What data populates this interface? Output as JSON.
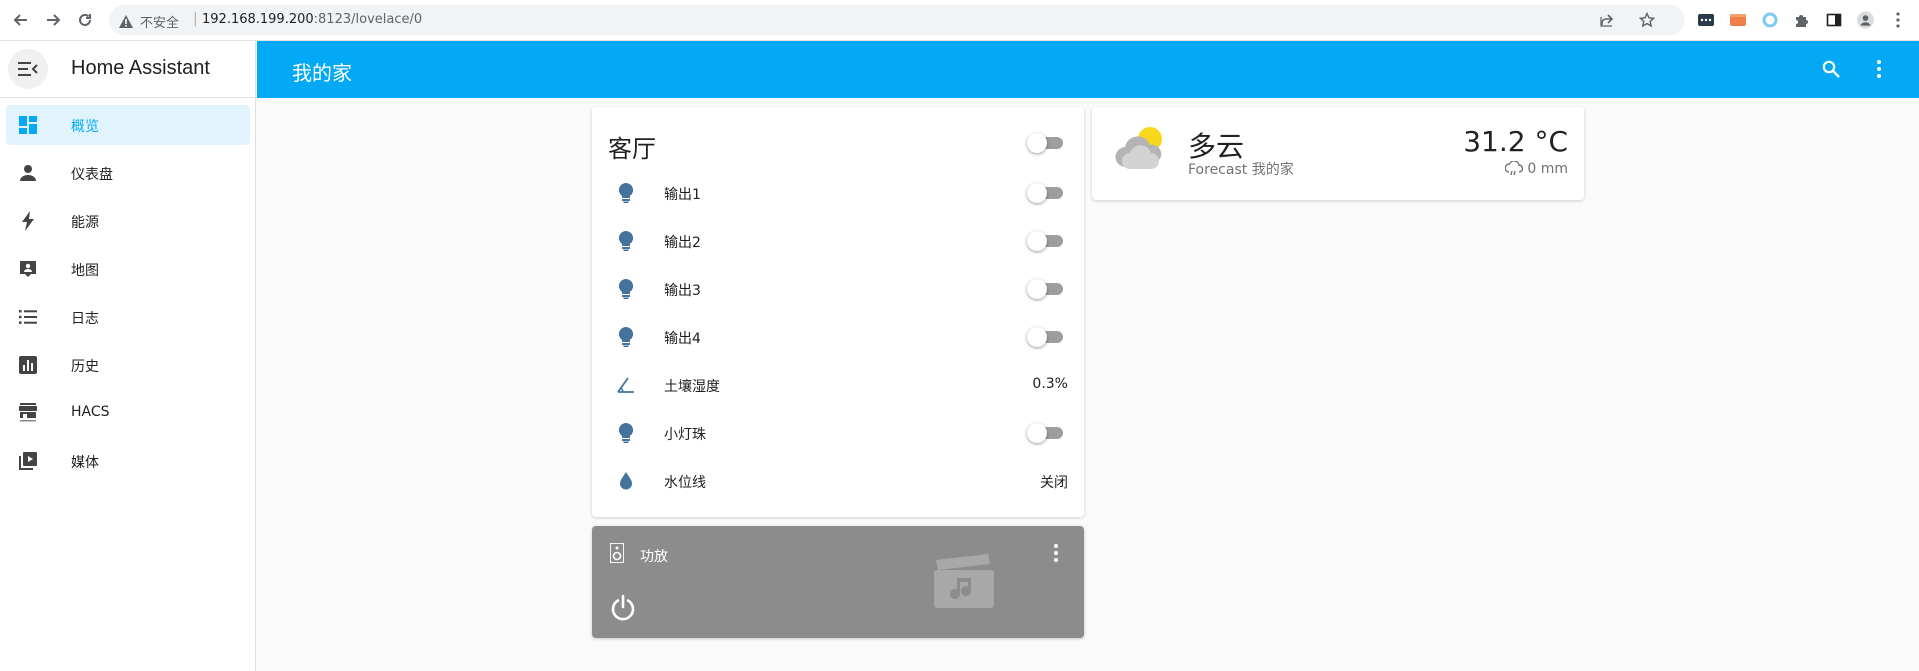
{
  "browser": {
    "insecure_label": "不安全",
    "url_host": "192.168.199.200",
    "url_path": ":8123/lovelace/0"
  },
  "sidebar": {
    "title": "Home Assistant",
    "items": [
      {
        "label": "概览",
        "icon": "dashboard-icon",
        "active": true
      },
      {
        "label": "仪表盘",
        "icon": "person-icon"
      },
      {
        "label": "能源",
        "icon": "lightning-bolt-icon"
      },
      {
        "label": "地图",
        "icon": "map-icon"
      },
      {
        "label": "日志",
        "icon": "list-icon"
      },
      {
        "label": "历史",
        "icon": "chart-box-icon"
      },
      {
        "label": "HACS",
        "icon": "hacs-icon"
      },
      {
        "label": "媒体",
        "icon": "play-box-multiple-icon"
      }
    ]
  },
  "header": {
    "title": "我的家"
  },
  "entities_card": {
    "title": "客厅",
    "header_toggle": false,
    "rows": [
      {
        "label": "输出1",
        "icon": "lightbulb-icon",
        "type": "toggle",
        "state": false
      },
      {
        "label": "输出2",
        "icon": "lightbulb-icon",
        "type": "toggle",
        "state": false
      },
      {
        "label": "输出3",
        "icon": "lightbulb-icon",
        "type": "toggle",
        "state": false
      },
      {
        "label": "输出4",
        "icon": "lightbulb-icon",
        "type": "toggle",
        "state": false
      },
      {
        "label": "土壤湿度",
        "icon": "angle-acute-icon",
        "type": "value",
        "value": "0.3%"
      },
      {
        "label": "小灯珠",
        "icon": "lightbulb-icon",
        "type": "toggle",
        "state": false
      },
      {
        "label": "水位线",
        "icon": "water-drop-icon",
        "type": "value",
        "value": "关闭"
      }
    ]
  },
  "weather_card": {
    "condition": "多云",
    "subtitle": "Forecast 我的家",
    "temperature": "31.2 °C",
    "precipitation": "0 mm",
    "icon": "partly-cloudy-icon"
  },
  "media_card": {
    "name": "功放",
    "icon": "speaker-icon",
    "background_icon": "movie-music-icon",
    "state": "off"
  },
  "colors": {
    "primary": "#03a9f4",
    "icon_blue": "#44739e",
    "sidebar_active_bg": "#e1f4fd",
    "media_bg": "#8c8c8c"
  }
}
